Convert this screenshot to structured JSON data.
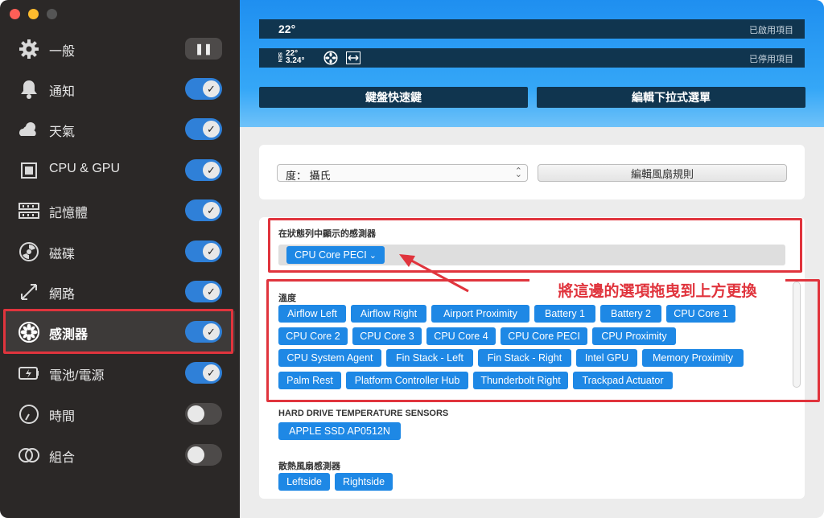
{
  "sidebar": {
    "items": [
      {
        "label": "一般",
        "icon": "gear-icon",
        "state": "pause"
      },
      {
        "label": "通知",
        "icon": "bell-icon",
        "state": "on"
      },
      {
        "label": "天氣",
        "icon": "weather-icon",
        "state": "on"
      },
      {
        "label": "CPU & GPU",
        "icon": "chip-icon",
        "state": "on"
      },
      {
        "label": "記憶體",
        "icon": "memory-icon",
        "state": "on"
      },
      {
        "label": "磁碟",
        "icon": "disk-icon",
        "state": "on"
      },
      {
        "label": "網路",
        "icon": "network-icon",
        "state": "on"
      },
      {
        "label": "感測器",
        "icon": "fan-icon",
        "state": "on"
      },
      {
        "label": "電池/電源",
        "icon": "battery-icon",
        "state": "on"
      },
      {
        "label": "時間",
        "icon": "clock-icon",
        "state": "off"
      },
      {
        "label": "組合",
        "icon": "combine-icon",
        "state": "off"
      }
    ],
    "selected": "感測器",
    "pause_glyph": "❚❚",
    "check_glyph": "✓"
  },
  "header": {
    "enabled_preview": "22°",
    "enabled_label": "已啟用項目",
    "disabled_preview_sen": "SEN",
    "disabled_preview_temp": "22°",
    "disabled_preview_volt": "3.24°",
    "disabled_label": "已停用項目",
    "keyboard_shortcuts_button": "鍵盤快速鍵",
    "edit_dropdown_button": "編輯下拉式選單"
  },
  "settings": {
    "unit_select_value": "度： 攝氏",
    "edit_fan_rules_button": "編輯風扇規則"
  },
  "statusbar_sensors": {
    "title": "在狀態列中顯示的感測器",
    "chips": [
      "CPU Core PECI"
    ]
  },
  "temperature": {
    "title": "溫度",
    "rows": [
      [
        "Airflow Left",
        "Airflow Right",
        "Airport Proximity",
        "Battery 1",
        "Battery 2",
        "CPU Core 1"
      ],
      [
        "CPU Core 2",
        "CPU Core 3",
        "CPU Core 4",
        "CPU Core PECI",
        "CPU Proximity"
      ],
      [
        "CPU System Agent",
        "Fin Stack - Left",
        "Fin Stack - Right",
        "Intel GPU",
        "Memory Proximity"
      ],
      [
        "Palm Rest",
        "Platform Controller Hub",
        "Thunderbolt Right",
        "Trackpad Actuator"
      ]
    ]
  },
  "hdd": {
    "title": "HARD DRIVE TEMPERATURE SENSORS",
    "chips": [
      "APPLE SSD AP0512N"
    ]
  },
  "fans": {
    "title": "散熱風扇感測器",
    "chips": [
      "Leftside",
      "Rightside"
    ]
  },
  "annotation": {
    "callout": "將這邊的選項拖曳到上方更換"
  },
  "colors": {
    "accent": "#1e88e5",
    "highlight": "#e0343d",
    "sidebar_bg": "#2b2827"
  }
}
